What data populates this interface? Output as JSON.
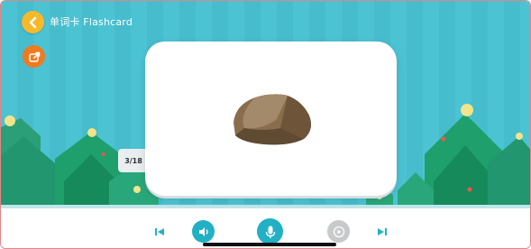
{
  "header": {
    "title": "单词卡 Flashcard"
  },
  "card": {
    "image_icon": "rock-image",
    "counter": "3/18"
  },
  "toolbar": {
    "buttons": [
      "first-card-icon",
      "speaker-icon",
      "microphone-icon",
      "play-icon",
      "last-card-icon"
    ]
  },
  "colors": {
    "sky": "#4cc3d3",
    "back_button": "#f7b92c",
    "share_button": "#f07a1e",
    "accent": "#22b0c4",
    "tree": "#1f9f6b"
  }
}
